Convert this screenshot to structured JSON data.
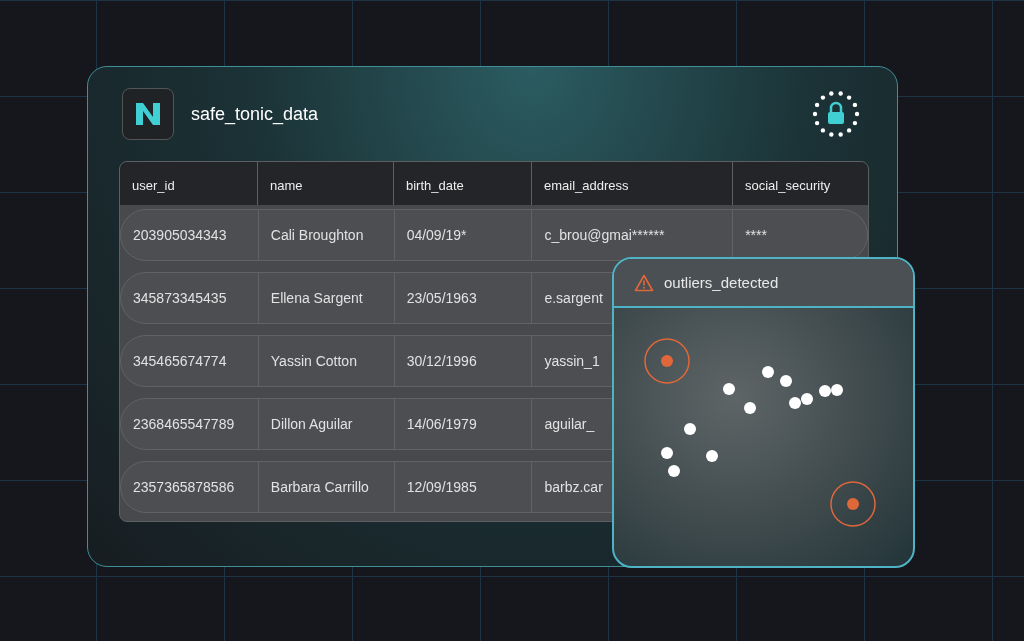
{
  "app": {
    "title": "safe_tonic_data"
  },
  "table": {
    "columns": [
      "user_id",
      "name",
      "birth_date",
      "email_address",
      "social_security"
    ],
    "rows": [
      {
        "cells": [
          "203905034343",
          "Cali Broughton",
          "04/09/19*",
          "c_brou@gmai******",
          "****"
        ]
      },
      {
        "cells": [
          "345873345435",
          "Ellena Sargent",
          "23/05/1963",
          "e.sargent"
        ]
      },
      {
        "cells": [
          "345465674774",
          "Yassin Cotton",
          "30/12/1996",
          "yassin_1"
        ]
      },
      {
        "cells": [
          "2368465547789",
          "Dillon Aguilar",
          "14/06/1979",
          "aguilar_"
        ]
      },
      {
        "cells": [
          "2357365878586",
          "Barbara Carrillo",
          "12/09/1985",
          "barbz.car"
        ]
      }
    ]
  },
  "outliers_panel": {
    "title": "outliers_detected"
  }
}
